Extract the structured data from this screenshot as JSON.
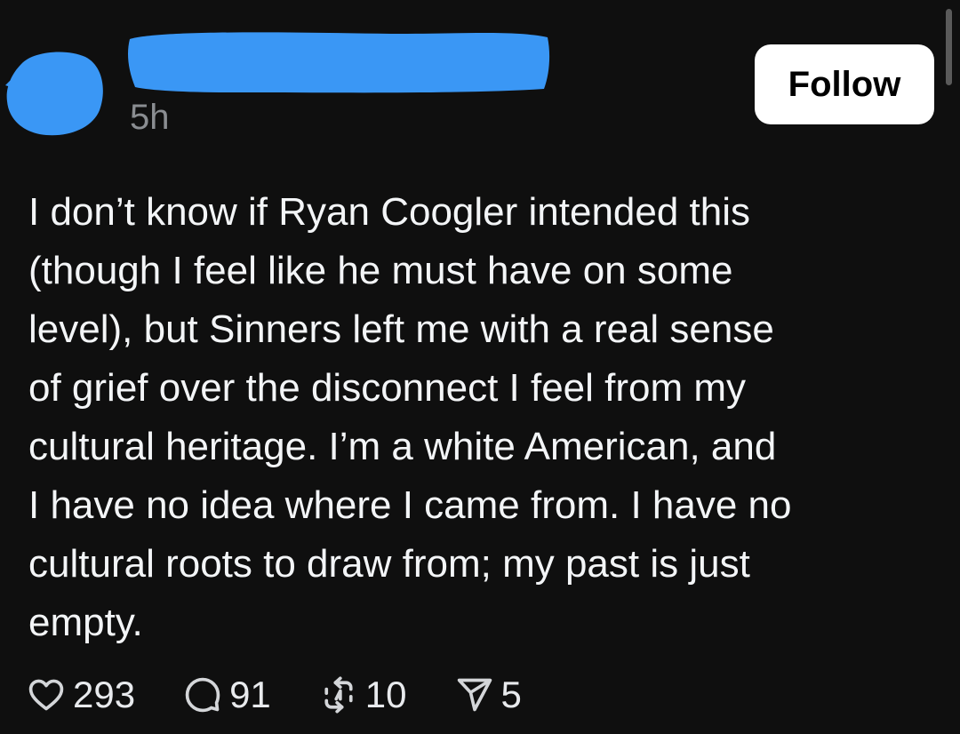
{
  "post": {
    "timestamp": "5h",
    "follow_label": "Follow",
    "body_lines": [
      "I don’t know if Ryan Coogler intended this",
      "(though I feel like he must have on some",
      "level), but Sinners left me with a real sense",
      "of grief over the disconnect I feel from my",
      "cultural heritage. I’m a white American, and",
      "I have no idea where I came from. I have no",
      "cultural roots to draw from; my past is just",
      "empty."
    ]
  },
  "actions": {
    "likes": {
      "icon": "heart-icon",
      "count": "293"
    },
    "replies": {
      "icon": "comment-icon",
      "count": "91"
    },
    "reposts": {
      "icon": "repost-icon",
      "count": "10"
    },
    "shares": {
      "icon": "send-icon",
      "count": "5"
    }
  },
  "colors": {
    "background": "#0f0f0f",
    "text": "#f3f5f7",
    "muted": "#8a8d91",
    "redaction": "#3a97f5",
    "button_bg": "#ffffff"
  }
}
